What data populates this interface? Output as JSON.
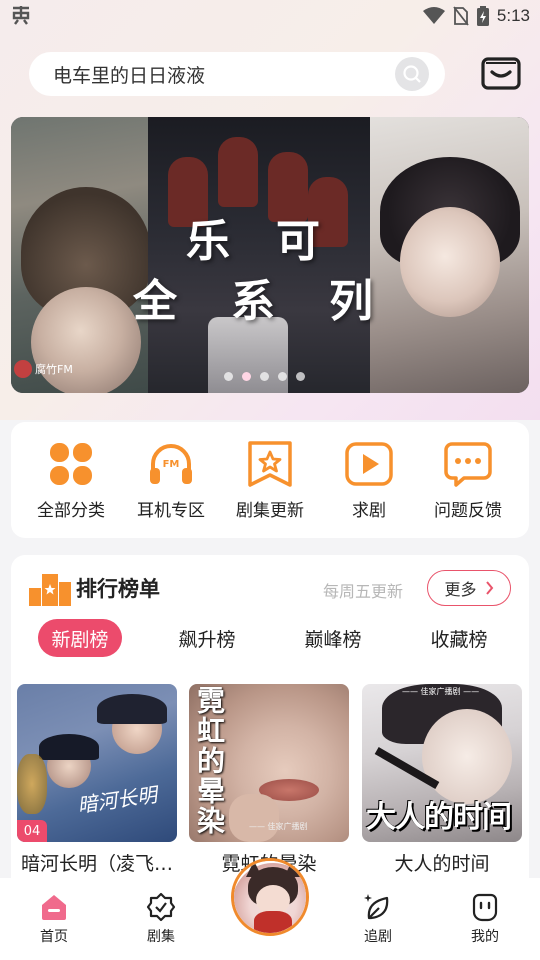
{
  "status_bar": {
    "time": "5:13",
    "icons": [
      "app-notification-icon",
      "wifi-icon",
      "no-sim-icon",
      "battery-charging-icon"
    ]
  },
  "search": {
    "value": "电车里的日日液液",
    "icon": "search-icon"
  },
  "header": {
    "inbox_icon": "inbox-icon"
  },
  "banner": {
    "title_line1": "乐可",
    "title_line2": "全系列",
    "watermark": "腐竹FM",
    "slide_count": 5,
    "active_slide": 1
  },
  "quick_actions": [
    {
      "label": "全部分类",
      "icon": "grid-icon"
    },
    {
      "label": "耳机专区",
      "icon": "headphones-fm-icon"
    },
    {
      "label": "剧集更新",
      "icon": "bookmark-star-icon"
    },
    {
      "label": "求剧",
      "icon": "play-icon"
    },
    {
      "label": "问题反馈",
      "icon": "chat-bubble-icon"
    }
  ],
  "ranking": {
    "title": "排行榜单",
    "update_note": "每周五更新",
    "more_label": "更多",
    "tabs": [
      {
        "label": "新剧榜",
        "active": true
      },
      {
        "label": "飙升榜",
        "active": false
      },
      {
        "label": "巅峰榜",
        "active": false
      },
      {
        "label": "收藏榜",
        "active": false
      }
    ],
    "items": [
      {
        "title": "暗河长明（凌飞…",
        "badge": "04",
        "cover_text": "暗河长明"
      },
      {
        "title": "霓虹的晕染",
        "cover_text": "霓虹的晕染",
        "cover_sub": "—— 佳家广播剧"
      },
      {
        "title": "大人的时间",
        "cover_text": "大人的时间",
        "cover_sub": "—— 佳家广播剧 ——"
      }
    ]
  },
  "bottom_nav": [
    {
      "label": "首页",
      "icon": "home-icon",
      "active": true
    },
    {
      "label": "剧集",
      "icon": "badge-check-icon",
      "active": false
    },
    {
      "label": "追剧",
      "icon": "leaf-sparkle-icon",
      "active": false
    },
    {
      "label": "我的",
      "icon": "user-face-icon",
      "active": false
    }
  ],
  "colors": {
    "accent_pink": "#ec4b6c",
    "accent_orange": "#f7912d"
  }
}
